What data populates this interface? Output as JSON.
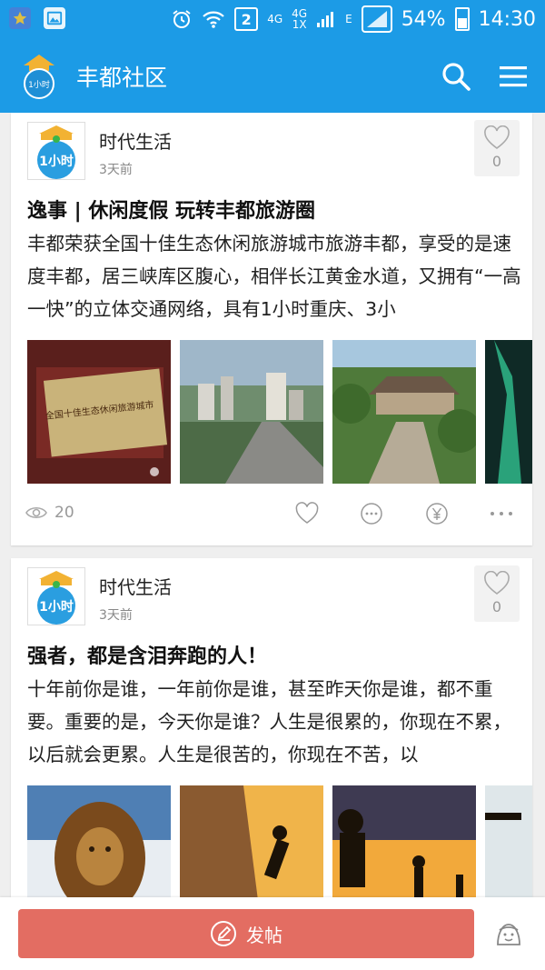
{
  "status_bar": {
    "network_2": "2",
    "net_4g_a": "4G",
    "net_4g_b": "4G",
    "net_1x": "1X",
    "net_e": "E",
    "battery": "54%",
    "time": "14:30",
    "icons": [
      "star-badge-icon",
      "gallery-icon",
      "alarm-icon",
      "wifi-icon",
      "signal-icon",
      "battery-icon"
    ]
  },
  "app_bar": {
    "title": "丰都社区",
    "logo_text": "1小时",
    "icons": [
      "search-icon",
      "menu-icon"
    ]
  },
  "posts": [
    {
      "author": "时代生活",
      "avatar_text": "1小时",
      "time": "3天前",
      "likes": "0",
      "title": "逸事 | 休闲度假 玩转丰都旅游圈",
      "body": "丰都荣获全国十佳生态休闲旅游城市旅游丰都，享受的是速度丰都，居三峡库区腹心，相伴长江黄金水道，又拥有“一高一快”的立体交通网络，具有1小时重庆、3小",
      "plaque_text": "全国十佳生态休闲旅游城市",
      "views": "20"
    },
    {
      "author": "时代生活",
      "avatar_text": "1小时",
      "time": "3天前",
      "likes": "0",
      "title": "强者，都是含泪奔跑的人！",
      "body": "十年前你是谁，一年前你是谁，甚至昨天你是谁，都不重要。重要的是，今天你是谁？人生是很累的，你现在不累，以后就会更累。人生是很苦的，你现在不苦，以"
    }
  ],
  "bottom_bar": {
    "post_button": "发帖"
  },
  "colors": {
    "primary": "#1c9be6",
    "post_button": "#e36d62",
    "background": "#efefef"
  }
}
